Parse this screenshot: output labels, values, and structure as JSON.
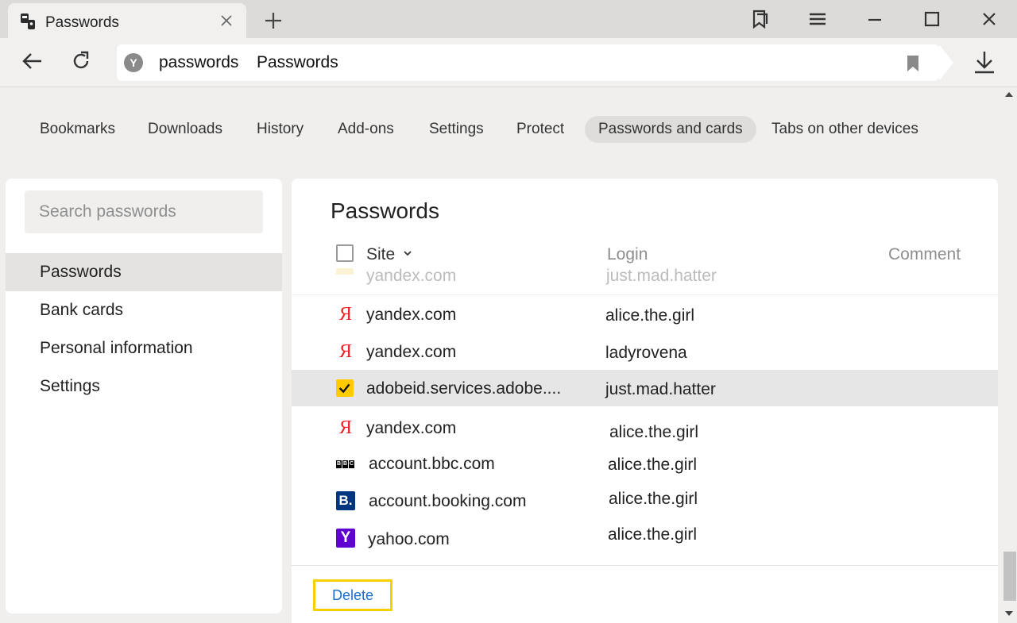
{
  "browser": {
    "tab_title": "Passwords",
    "address_host": "passwords",
    "address_title": "Passwords"
  },
  "section_nav": [
    "Bookmarks",
    "Downloads",
    "History",
    "Add-ons",
    "Settings",
    "Protect",
    "Passwords and cards",
    "Tabs on other devices"
  ],
  "sidebar": {
    "search_placeholder": "Search passwords",
    "items": [
      "Passwords",
      "Bank cards",
      "Personal information",
      "Settings"
    ]
  },
  "main": {
    "title": "Passwords",
    "columns": {
      "site": "Site",
      "login": "Login",
      "comment": "Comment"
    },
    "partial_row": {
      "site": "yandex.com",
      "login": "just.mad.hatter"
    },
    "rows": [
      {
        "icon": "yandex-icon",
        "site": "yandex.com",
        "login": "alice.the.girl",
        "selected": false
      },
      {
        "icon": "yandex-icon",
        "site": "yandex.com",
        "login": "ladyrovena",
        "selected": false
      },
      {
        "icon": "checkbox-checked-icon",
        "site": "adobeid.services.adobe....",
        "login": "just.mad.hatter",
        "selected": true
      },
      {
        "icon": "yandex-icon",
        "site": "yandex.com",
        "login": "alice.the.girl",
        "selected": false
      },
      {
        "icon": "bbc-icon",
        "site": "account.bbc.com",
        "login": "alice.the.girl",
        "selected": false
      },
      {
        "icon": "booking-icon",
        "site": "account.booking.com",
        "login": "alice.the.girl",
        "selected": false
      },
      {
        "icon": "yahoo-icon",
        "site": "yahoo.com",
        "login": "alice.the.girl",
        "selected": false
      }
    ],
    "delete_label": "Delete"
  },
  "colors": {
    "accent_yellow": "#ffcc00",
    "link_blue": "#1a6ec9",
    "yandex_red": "#ee2222"
  }
}
